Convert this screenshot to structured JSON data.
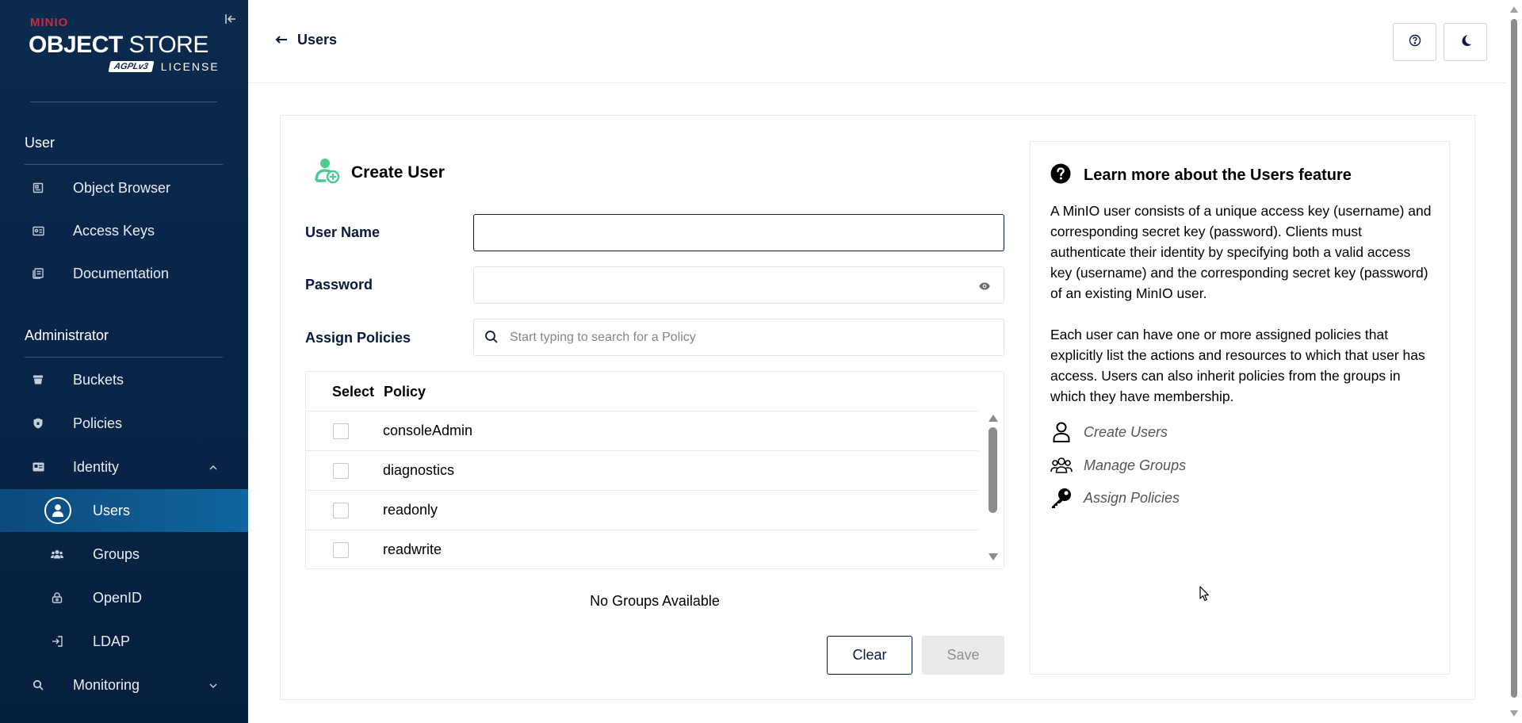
{
  "sidebar": {
    "logo": {
      "brand": "MINIO",
      "product_bold": "OBJECT",
      "product_regular": " STORE",
      "badge": "AGPLv3",
      "license": "LICENSE"
    },
    "sections": {
      "user": "User",
      "administrator": "Administrator"
    },
    "items": [
      {
        "label": "Object Browser",
        "icon": "object-browser-icon"
      },
      {
        "label": "Access Keys",
        "icon": "access-keys-icon"
      },
      {
        "label": "Documentation",
        "icon": "documentation-icon"
      },
      {
        "label": "Buckets",
        "icon": "buckets-icon"
      },
      {
        "label": "Policies",
        "icon": "policies-icon"
      },
      {
        "label": "Identity",
        "icon": "identity-icon"
      },
      {
        "label": "Users",
        "icon": "user-icon"
      },
      {
        "label": "Groups",
        "icon": "groups-icon"
      },
      {
        "label": "OpenID",
        "icon": "openid-icon"
      },
      {
        "label": "LDAP",
        "icon": "ldap-icon"
      },
      {
        "label": "Monitoring",
        "icon": "monitoring-icon"
      }
    ]
  },
  "header": {
    "back_label": "Users"
  },
  "form": {
    "title": "Create User",
    "username_label": "User Name",
    "username_value": "",
    "password_label": "Password",
    "password_value": "",
    "policies_label": "Assign Policies",
    "policy_search_placeholder": "Start typing to search for a Policy",
    "table": {
      "col_select": "Select",
      "col_policy": "Policy",
      "rows": [
        {
          "name": "consoleAdmin",
          "checked": false
        },
        {
          "name": "diagnostics",
          "checked": false
        },
        {
          "name": "readonly",
          "checked": false
        },
        {
          "name": "readwrite",
          "checked": false
        }
      ]
    },
    "no_groups": "No Groups Available",
    "clear_label": "Clear",
    "save_label": "Save"
  },
  "help": {
    "title": "Learn more about the Users feature",
    "paragraph1": "A MinIO user consists of a unique access key (username) and corresponding secret key (password). Clients must authenticate their identity by specifying both a valid access key (username) and the corresponding secret key (password) of an existing MinIO user.",
    "paragraph2": "Each user can have one or more assigned policies that explicitly list the actions and resources to which that user has access. Users can also inherit policies from the groups in which they have membership.",
    "links": [
      {
        "label": "Create Users",
        "icon": "user-outline-icon"
      },
      {
        "label": "Manage Groups",
        "icon": "groups-outline-icon"
      },
      {
        "label": "Assign Policies",
        "icon": "key-icon"
      }
    ]
  },
  "colors": {
    "sidebar_bg": "#0b2a4d",
    "active_item": "#11669f",
    "brand_red": "#c72c48",
    "accent_green": "#4ccb92",
    "text_dark": "#07193e"
  }
}
